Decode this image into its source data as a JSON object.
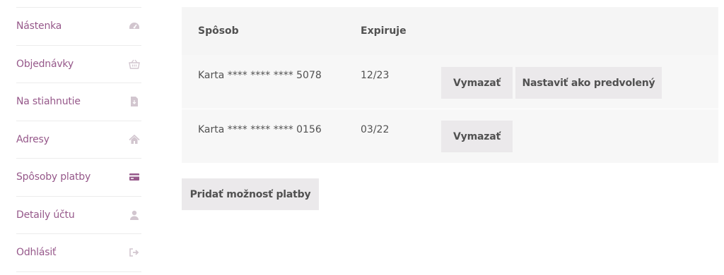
{
  "sidebar": {
    "items": [
      {
        "label": "Nástenka",
        "icon": "dashboard-icon",
        "active": false
      },
      {
        "label": "Objednávky",
        "icon": "basket-icon",
        "active": false
      },
      {
        "label": "Na stiahnutie",
        "icon": "file-download-icon",
        "active": false
      },
      {
        "label": "Adresy",
        "icon": "home-icon",
        "active": false
      },
      {
        "label": "Spôsoby platby",
        "icon": "credit-card-icon",
        "active": true
      },
      {
        "label": "Detaily účtu",
        "icon": "user-icon",
        "active": false
      },
      {
        "label": "Odhlásiť",
        "icon": "sign-out-icon",
        "active": false
      }
    ]
  },
  "table": {
    "headers": {
      "method": "Spôsob",
      "expires": "Expiruje"
    },
    "rows": [
      {
        "method": "Karta **** **** **** 5078",
        "expires": "12/23",
        "delete_label": "Vymazať",
        "default_label": "Nastaviť ako predvolený"
      },
      {
        "method": "Karta **** **** **** 0156",
        "expires": "03/22",
        "delete_label": "Vymazať"
      }
    ]
  },
  "add_payment_label": "Pridať možnosť platby",
  "colors": {
    "accent": "#96588a",
    "icon_inactive": "#d2c6cf",
    "icon_active": "#96588a",
    "button_bg": "#ebe9eb"
  }
}
